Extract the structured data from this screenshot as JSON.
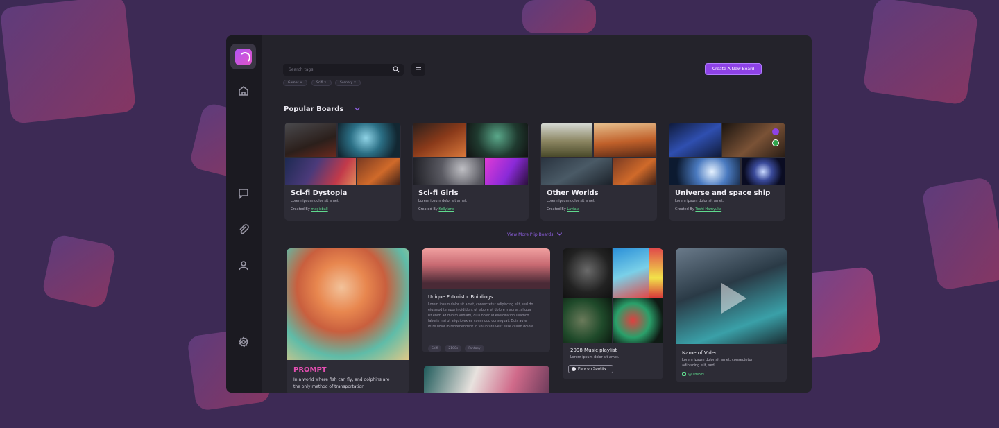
{
  "search": {
    "placeholder": "Search tags"
  },
  "tags": [
    "Games",
    "Scifi",
    "Scenery"
  ],
  "create_button": "Create A New Board",
  "section_title": "Popular Boards",
  "boards": [
    {
      "title": "Sci-fi Dystopia",
      "desc": "Lorem ipsum dolor sit amet.",
      "created_prefix": "Created By",
      "author": "magicball"
    },
    {
      "title": "Sci-fi Girls",
      "desc": "Lorem ipsum dolor sit amet.",
      "created_prefix": "Created By",
      "author": "Kellyjane"
    },
    {
      "title": "Other Worlds",
      "desc": "Lorem ipsum dolor sit amet.",
      "created_prefix": "Created By",
      "author": "Laviala"
    },
    {
      "title": "Universe and space ship",
      "desc": "Lorem ipsum dolor sit amet.",
      "created_prefix": "Created By",
      "author": "Toshi Hamyuka"
    }
  ],
  "view_more": "View More Plip Boards",
  "prompt_card": {
    "label": "PROMPT",
    "line1": "In a world where fish can fly, and dolphins are",
    "line2": "the only method of transportation"
  },
  "building_card": {
    "title": "Unique Futuristic Buildings",
    "lines": [
      "Lorem ipsum dolor sit amet, consectetur adipiscing elit, sed do",
      "eiusmod tempor incididunt ut labore et dolore magna . aliqua.",
      "Ut enim ad minim veniam, quis nostrud exercitation ullamco",
      "laboris nisi ut aliquip ex ea commodo consequat. Duis aute",
      "irure dolor in reprehenderit in voluptate velit esse cillum dolore"
    ],
    "tags": [
      "Scifi",
      "2100s",
      "Fantasy"
    ]
  },
  "playlist_card": {
    "title": "2098 Music playlist",
    "desc": "Lorem ipsum dolor sit amet.",
    "button": "Play on Spotify"
  },
  "video_card": {
    "title": "Name of Video",
    "line1": "Lorem ipsum dolor sit amet, consectetur",
    "line2": "adipiscing elit, sed",
    "handle": "@IlimiSci"
  },
  "colors": {
    "accent": "#8e42e6",
    "link": "#5fd98d",
    "prompt": "#e64fb3"
  }
}
